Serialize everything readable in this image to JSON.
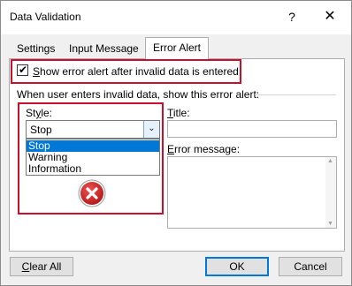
{
  "window": {
    "title": "Data Validation",
    "help": "?",
    "close": "✕"
  },
  "tabs": [
    {
      "label": "Settings",
      "active": false
    },
    {
      "label": "Input Message",
      "active": false
    },
    {
      "label": "Error Alert",
      "active": true
    }
  ],
  "error_alert": {
    "show_alert_label": "Show error alert after invalid data is entered",
    "show_alert_checked": true,
    "group_label": "When user enters invalid data, show this error alert:",
    "style_label": "Style:",
    "style_selected": "Stop",
    "style_options": [
      "Stop",
      "Warning",
      "Information"
    ],
    "title_label": "Title:",
    "title_value": "",
    "error_message_label": "Error message:",
    "error_message_value": "",
    "icon": "stop-error-icon"
  },
  "buttons": {
    "clear_all": "Clear All",
    "ok": "OK",
    "cancel": "Cancel"
  },
  "colors": {
    "highlight": "#c8102e",
    "selection": "#0078d7",
    "stop_icon": "#c62828"
  }
}
